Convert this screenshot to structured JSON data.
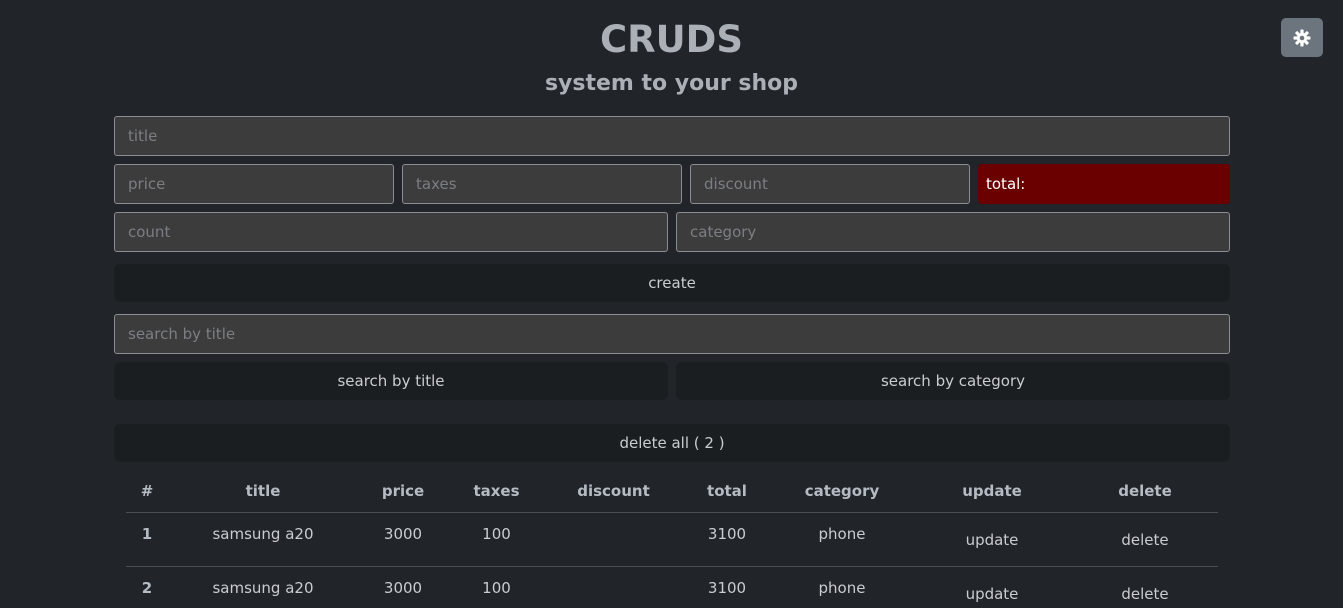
{
  "theme_toggle": {
    "icon": "gear-icon"
  },
  "header": {
    "title": "CRUDS",
    "subtitle": "system to your shop"
  },
  "form": {
    "title_placeholder": "title",
    "price_placeholder": "price",
    "taxes_placeholder": "taxes",
    "discount_placeholder": "discount",
    "total_label": "total:",
    "count_placeholder": "count",
    "category_placeholder": "category",
    "create_label": "create"
  },
  "search": {
    "placeholder": "search by title",
    "by_title_label": "search by title",
    "by_category_label": "search by category"
  },
  "delete_all_label": "delete all ( 2 )",
  "table": {
    "headers": [
      "#",
      "title",
      "price",
      "taxes",
      "discount",
      "total",
      "category",
      "update",
      "delete"
    ],
    "rows": [
      {
        "num": "1",
        "title": "samsung a20",
        "price": "3000",
        "taxes": "100",
        "discount": "",
        "total": "3100",
        "category": "phone",
        "update": "update",
        "delete": "delete"
      },
      {
        "num": "2",
        "title": "samsung a20",
        "price": "3000",
        "taxes": "100",
        "discount": "",
        "total": "3100",
        "category": "phone",
        "update": "update",
        "delete": "delete"
      }
    ]
  },
  "colors": {
    "background": "#212429",
    "input_bg": "#3d3c3c",
    "total_bg": "#6b0000",
    "button_bg": "#1b1e21",
    "toggle_bg": "#6c757d"
  }
}
